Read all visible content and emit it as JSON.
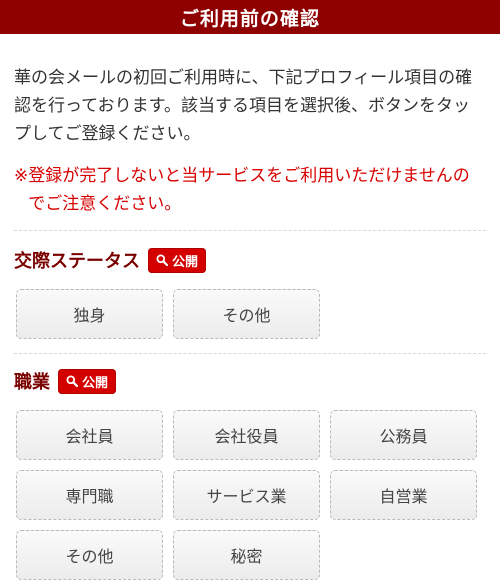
{
  "header": {
    "title": "ご利用前の確認"
  },
  "intro": {
    "text": "華の会メールの初回ご利用時に、下記プロフィール項目の確認を行っております。該当する項目を選択後、ボタンをタップしてご登録ください。"
  },
  "warning": {
    "mark": "※",
    "text": "登録が完了しないと当サービスをご利用いただけませんのでご注意ください。"
  },
  "sections": {
    "relationship": {
      "title": "交際ステータス",
      "badge": "公開",
      "options": [
        "独身",
        "その他"
      ]
    },
    "occupation": {
      "title": "職業",
      "badge": "公開",
      "options": [
        "会社員",
        "会社役員",
        "公務員",
        "専門職",
        "サービス業",
        "自営業",
        "その他",
        "秘密"
      ]
    }
  },
  "colors": {
    "header_bg": "#8f0000",
    "badge_bg": "#d40000",
    "warning_text": "#d80000"
  },
  "icons": {
    "badge_icon": "search-icon"
  }
}
